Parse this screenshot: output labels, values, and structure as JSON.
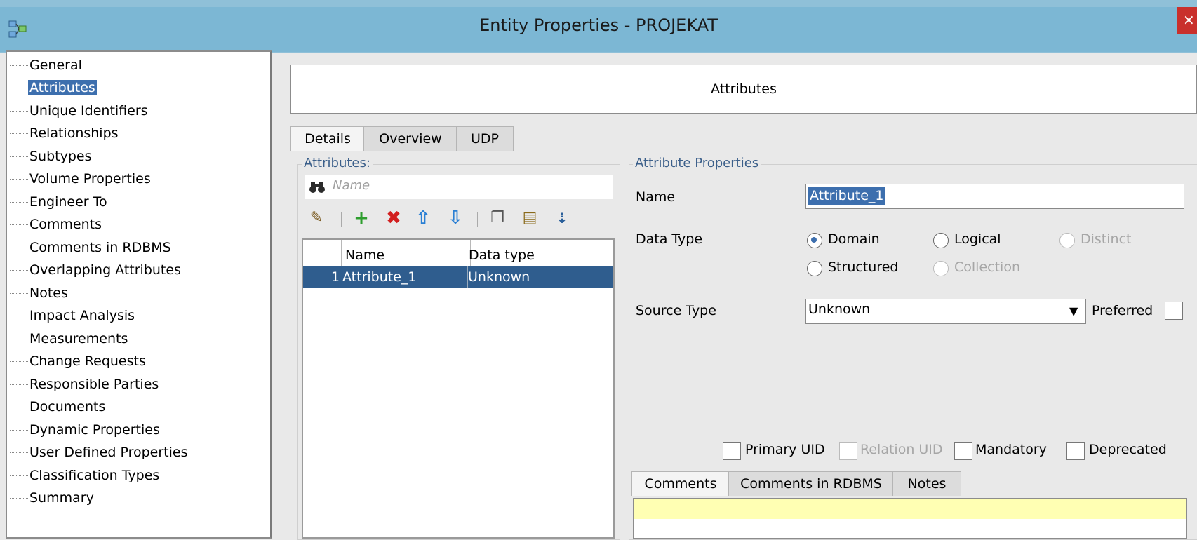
{
  "window": {
    "title": "Entity Properties - PROJEKAT",
    "close_glyph": "×"
  },
  "tree": {
    "items": [
      "General",
      "Attributes",
      "Unique Identifiers",
      "Relationships",
      "Subtypes",
      "Volume Properties",
      "Engineer To",
      "Comments",
      "Comments in RDBMS",
      "Overlapping Attributes",
      "Notes",
      "Impact Analysis",
      "Measurements",
      "Change Requests",
      "Responsible Parties",
      "Documents",
      "Dynamic Properties",
      "User Defined Properties",
      "Classification Types",
      "Summary"
    ],
    "selected": "Attributes"
  },
  "header": {
    "title": "Attributes"
  },
  "tabs": {
    "details": "Details",
    "overview": "Overview",
    "udp": "UDP"
  },
  "attributes_group": {
    "title": "Attributes:",
    "search_placeholder": "Name",
    "columns": {
      "name": "Name",
      "data_type": "Data type"
    },
    "rows": [
      {
        "index": "1",
        "name": "Attribute_1",
        "data_type": "Unknown"
      }
    ]
  },
  "toolbar_icons": [
    "edit-icon",
    "add-icon",
    "delete-icon",
    "move-up-icon",
    "move-down-icon",
    "copy-icon",
    "paste-icon",
    "sort-icon"
  ],
  "properties": {
    "title": "Attribute Properties",
    "name_label": "Name",
    "name_value": "Attribute_1",
    "data_type_label": "Data Type",
    "data_type_options": {
      "domain": "Domain",
      "logical": "Logical",
      "distinct": "Distinct",
      "structured": "Structured",
      "collection": "Collection"
    },
    "data_type_selected": "Domain",
    "source_type_label": "Source Type",
    "source_type_value": "Unknown",
    "preferred_label": "Preferred",
    "checks": {
      "primary_uid": "Primary UID",
      "relation_uid": "Relation UID",
      "mandatory": "Mandatory",
      "deprecated": "Deprecated"
    }
  },
  "bottom_tabs": {
    "comments": "Comments",
    "comments_rdbms": "Comments in RDBMS",
    "notes": "Notes"
  },
  "colors": {
    "selection": "#3d6fae",
    "titlebar": "#7cb7d4",
    "group_title": "#3b5f8a",
    "comment_highlight": "#ffffb3"
  }
}
